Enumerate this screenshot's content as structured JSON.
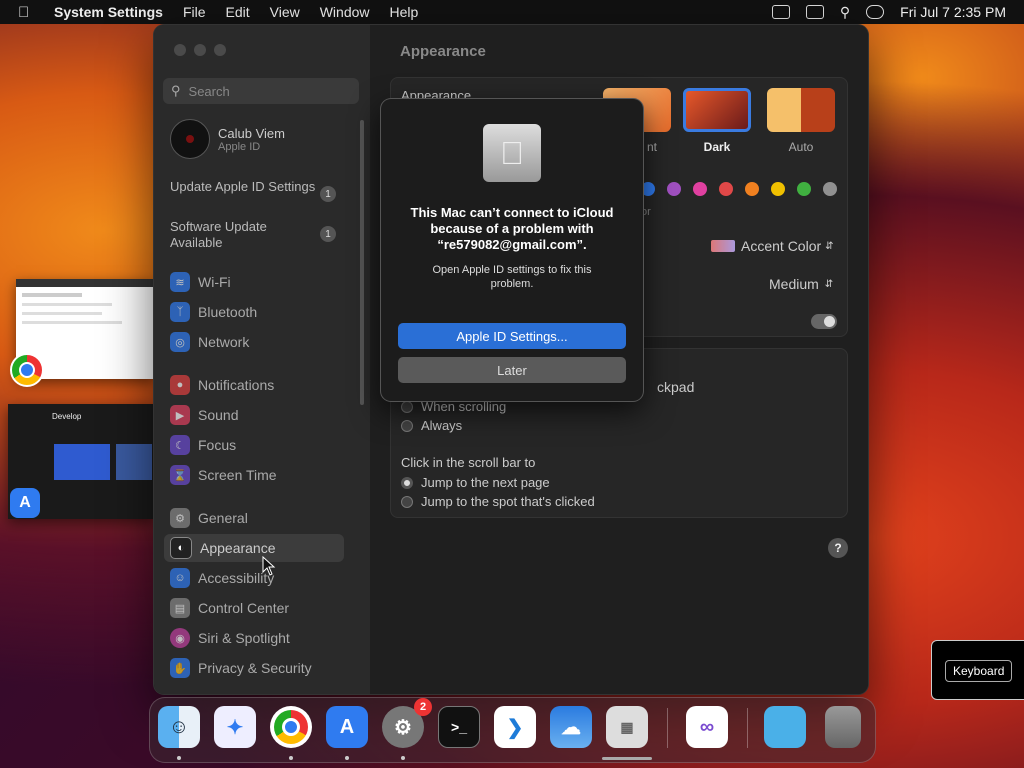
{
  "menubar": {
    "app_name": "System Settings",
    "menus": [
      "File",
      "Edit",
      "View",
      "Window",
      "Help"
    ],
    "datetime": "Fri Jul 7  2:35 PM"
  },
  "sidebar": {
    "search_placeholder": "Search",
    "user_name": "Calub Viem",
    "user_sub": "Apple ID",
    "updates": [
      {
        "label": "Update Apple ID Settings",
        "count": "1"
      },
      {
        "label": "Software Update Available",
        "count": "1"
      }
    ],
    "items": [
      {
        "label": "Wi-Fi",
        "icon": "wifi-icon",
        "color": "#2f7bf0"
      },
      {
        "label": "Bluetooth",
        "icon": "bluetooth-icon",
        "color": "#2f7bf0"
      },
      {
        "label": "Network",
        "icon": "globe-icon",
        "color": "#2f7bf0"
      },
      {
        "label": "Notifications",
        "icon": "bell-icon",
        "color": "#e04040"
      },
      {
        "label": "Sound",
        "icon": "speaker-icon",
        "color": "#e04060"
      },
      {
        "label": "Focus",
        "icon": "moon-icon",
        "color": "#6a4bd0"
      },
      {
        "label": "Screen Time",
        "icon": "hourglass-icon",
        "color": "#6a4bd0"
      },
      {
        "label": "General",
        "icon": "gear-icon",
        "color": "#888888"
      },
      {
        "label": "Appearance",
        "icon": "appearance-icon",
        "color": "#222222"
      },
      {
        "label": "Accessibility",
        "icon": "accessibility-icon",
        "color": "#2f7bf0"
      },
      {
        "label": "Control Center",
        "icon": "control-center-icon",
        "color": "#888888"
      },
      {
        "label": "Siri & Spotlight",
        "icon": "siri-icon",
        "color": "#c040a0"
      },
      {
        "label": "Privacy & Security",
        "icon": "hand-icon",
        "color": "#2f7bf0"
      }
    ]
  },
  "content": {
    "page_title": "Appearance",
    "appearance_label": "Appearance",
    "themes": [
      {
        "label": "nt",
        "selected": false
      },
      {
        "label": "Dark",
        "selected": true
      },
      {
        "label": "Auto",
        "selected": false
      }
    ],
    "accent_colors": [
      "#2f7bf0",
      "#a050c0",
      "#e040a0",
      "#e04848",
      "#f08020",
      "#f0c000",
      "#40b040",
      "#909090"
    ],
    "accent_partial_label": "or",
    "highlight_value": "Accent Color",
    "sidebar_icon_size": "Medium",
    "scroll_partial_label": "ckpad",
    "scroll_options": [
      "When scrolling",
      "Always"
    ],
    "click_label": "Click in the scroll bar to",
    "click_options": [
      "Jump to the next page",
      "Jump to the spot that's clicked"
    ],
    "help": "?"
  },
  "alert": {
    "title": "This Mac can’t connect to iCloud because of a problem with “re579082@gmail.com”.",
    "message": "Open Apple ID settings to fix this problem.",
    "primary_button": "Apple ID Settings...",
    "secondary_button": "Later"
  },
  "keyboard_badge": "Keyboard",
  "desktop": {
    "develop_window_title": "Develop"
  },
  "dock": {
    "settings_badge": "2",
    "apps": [
      "Finder",
      "Safari",
      "Chrome",
      "App Store",
      "System Settings",
      "Terminal",
      "VS Code",
      "Weather",
      "Launchpad",
      "Visual Studio",
      "Downloads",
      "Trash"
    ]
  }
}
